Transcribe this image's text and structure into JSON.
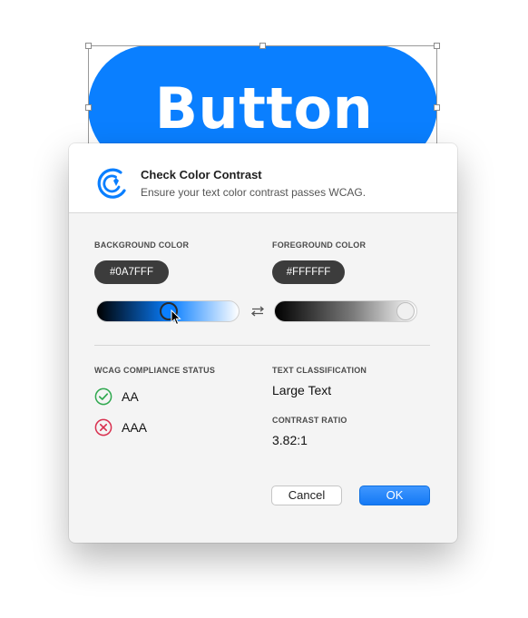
{
  "canvas": {
    "button_label": "Button",
    "button_color": "#0A7FFF"
  },
  "dialog": {
    "title": "Check Color Contrast",
    "subtitle": "Ensure your text color contrast passes WCAG.",
    "logo_icon": "contrast-logo-icon",
    "accent_color": "#0A7FFF",
    "background": {
      "label": "BACKGROUND COLOR",
      "hex": "#0A7FFF"
    },
    "foreground": {
      "label": "FOREGROUND COLOR",
      "hex": "#FFFFFF"
    },
    "swap_icon": "swap-arrows-icon",
    "compliance": {
      "label": "WCAG COMPLIANCE STATUS",
      "items": [
        {
          "level": "AA",
          "status": "pass",
          "icon": "check-circle-icon",
          "color": "#2fa84f"
        },
        {
          "level": "AAA",
          "status": "fail",
          "icon": "x-circle-icon",
          "color": "#d9304f"
        }
      ]
    },
    "classification": {
      "label": "TEXT CLASSIFICATION",
      "value": "Large Text"
    },
    "ratio": {
      "label": "CONTRAST RATIO",
      "value": "3.82:1"
    },
    "buttons": {
      "cancel": "Cancel",
      "ok": "OK"
    }
  }
}
